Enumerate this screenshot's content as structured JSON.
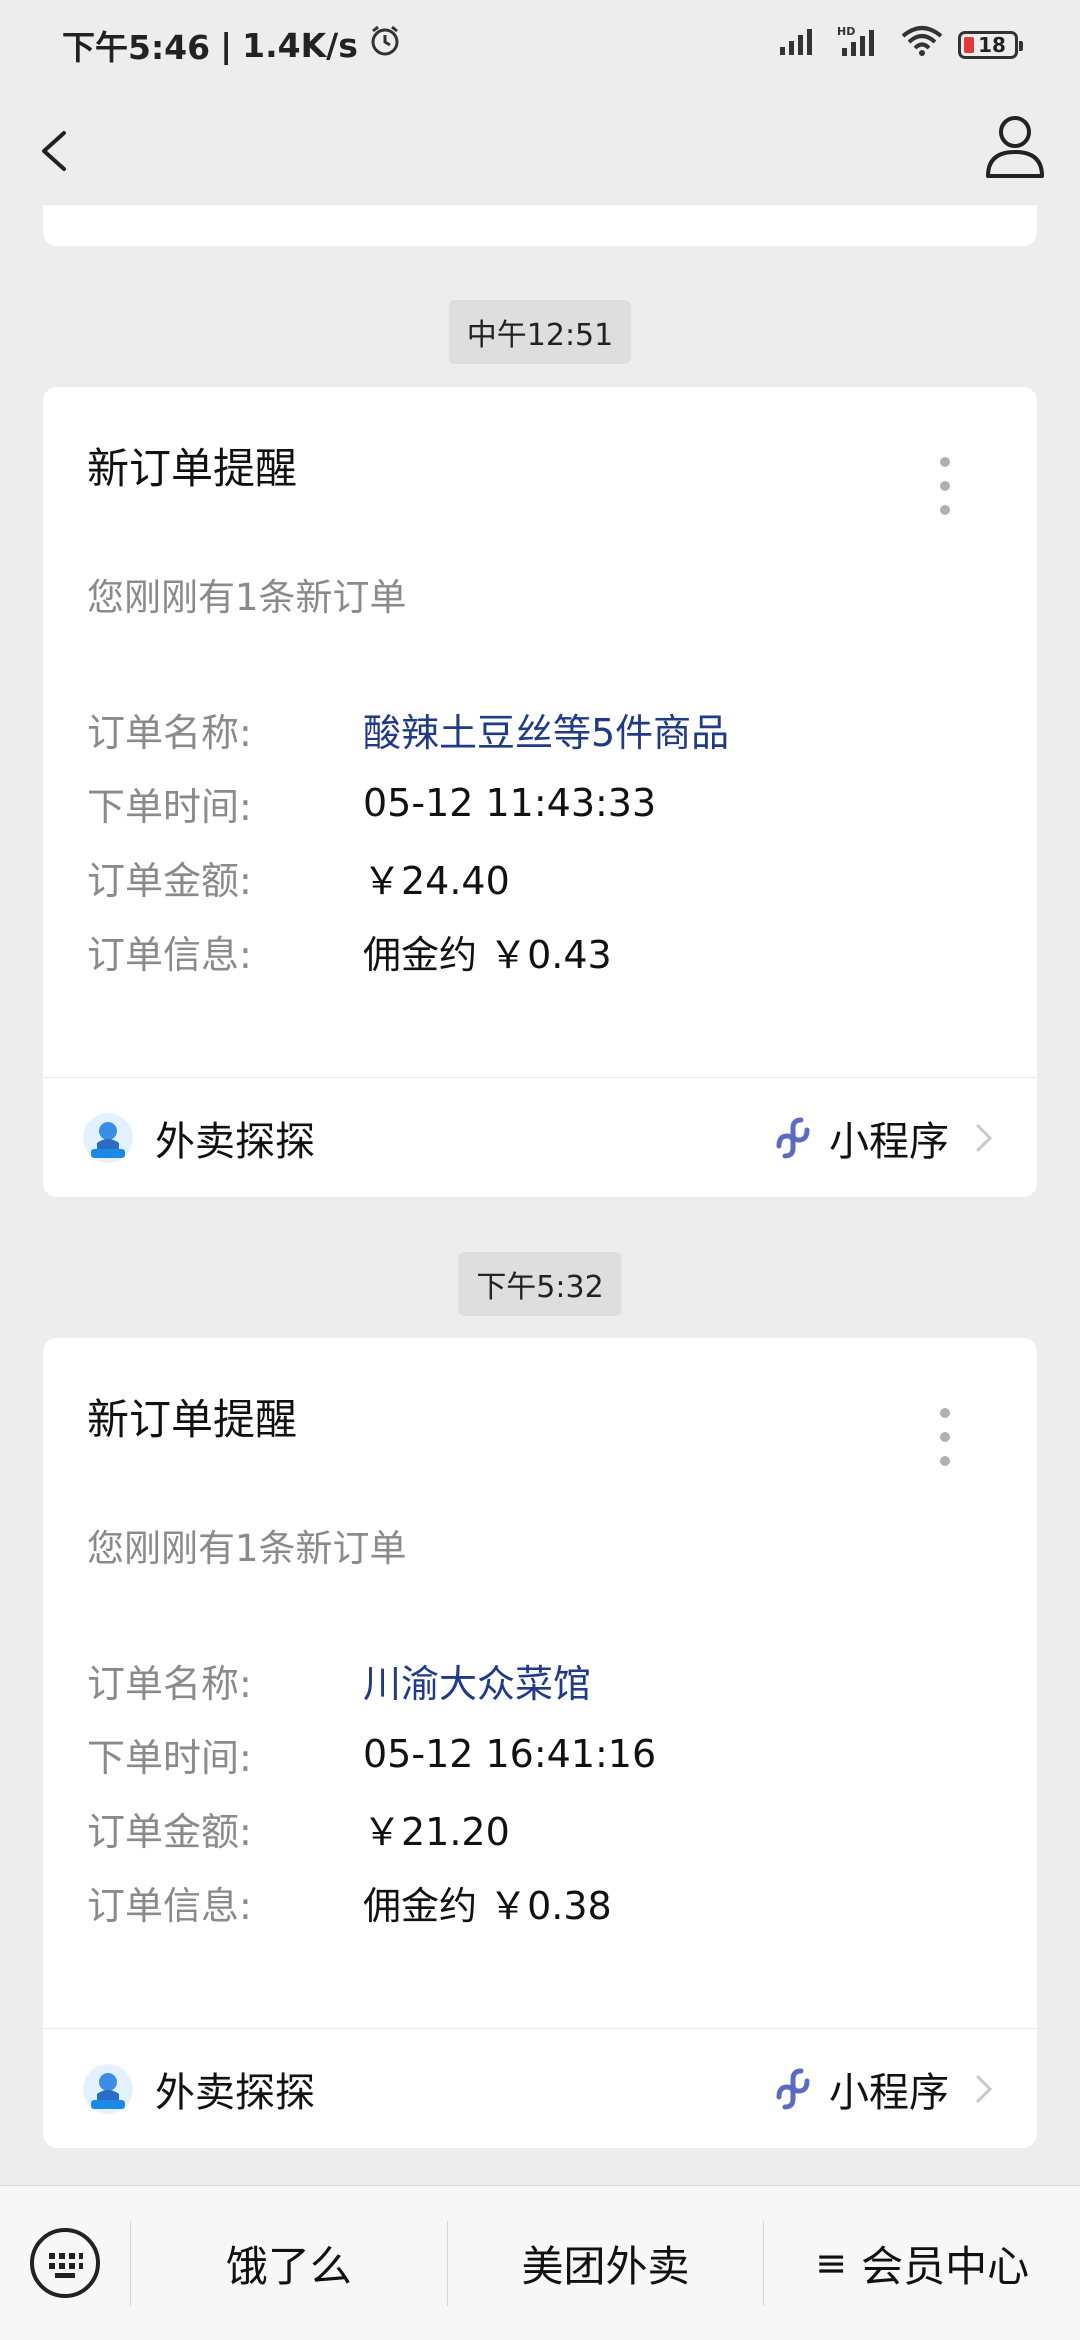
{
  "status_bar": {
    "time": "下午5:46",
    "network_speed": "1.4K/s",
    "battery": "18"
  },
  "time_chips": [
    "中午12:51",
    "下午5:32"
  ],
  "messages": [
    {
      "title": "新订单提醒",
      "subtitle": "您刚刚有1条新订单",
      "rows": [
        {
          "label": "订单名称:",
          "value": "酸辣土豆丝等5件商品"
        },
        {
          "label": "下单时间:",
          "value": "05-12 11:43:33"
        },
        {
          "label": "订单金额:",
          "value": "￥24.40"
        },
        {
          "label": "订单信息:",
          "value": "佣金约 ￥0.43"
        }
      ],
      "app_name": "外卖探探",
      "mini_label": "小程序"
    },
    {
      "title": "新订单提醒",
      "subtitle": "您刚刚有1条新订单",
      "rows": [
        {
          "label": "订单名称:",
          "value": "川渝大众菜馆"
        },
        {
          "label": "下单时间:",
          "value": "05-12 16:41:16"
        },
        {
          "label": "订单金额:",
          "value": "￥21.20"
        },
        {
          "label": "订单信息:",
          "value": "佣金约 ￥0.38"
        }
      ],
      "app_name": "外卖探探",
      "mini_label": "小程序"
    }
  ],
  "bottom_menu": {
    "item1": "饿了么",
    "item2": "美团外卖",
    "item3": "会员中心",
    "item3_icon": "≡"
  },
  "colors": {
    "background": "#ededed",
    "link_value": "#1f3a86",
    "label_gray": "#8a8a8a",
    "mini_program_icon": "#5b6bc0"
  }
}
